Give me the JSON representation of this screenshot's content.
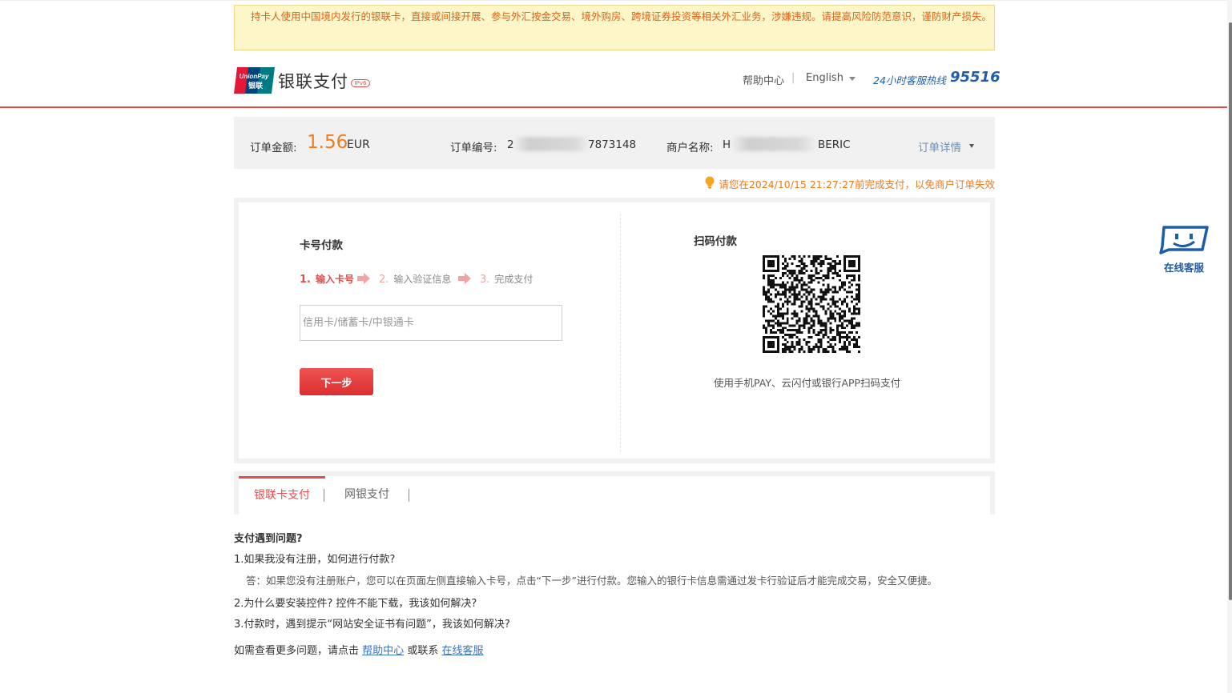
{
  "warning": "持卡人使用中国境内发行的银联卡，直接或间接开展、参与外汇按金交易、境外购房、跨境证券投资等相关外汇业务，涉嫌违规。请提高风险防范意识，谨防财产损失。",
  "header": {
    "logo_text": "UnionPay 银联",
    "brand_title": "银联支付",
    "ipv6_tag": "IPv6",
    "help_center": "帮助中心",
    "separator": "|",
    "language": "English",
    "hotline_label": "24小时客服热线",
    "hotline_number": "95516"
  },
  "order": {
    "amount_label": "订单金额:",
    "amount_value": "1.56",
    "currency": "EUR",
    "order_no_label": "订单编号:",
    "order_no_prefix": "2",
    "order_no_suffix": "7873148",
    "merchant_label": "商户名称:",
    "merchant_prefix": "H",
    "merchant_suffix": "BERIC",
    "details_link": "订单详情"
  },
  "deadline": "请您在2024/10/15 21:27:27前完成支付，以免商户订单失效",
  "card_pay": {
    "title": "卡号付款",
    "steps": [
      {
        "num": "1.",
        "label": "输入卡号"
      },
      {
        "num": "2.",
        "label": "输入验证信息"
      },
      {
        "num": "3.",
        "label": "完成支付"
      }
    ],
    "input_placeholder": "信用卡/储蓄卡/中银通卡",
    "next_button": "下一步"
  },
  "qr_pay": {
    "title": "扫码付款",
    "hint": "使用手机PAY、云闪付或银行APP扫码支付"
  },
  "tabs": [
    {
      "label": "银联卡支付",
      "active": true
    },
    {
      "label": "网银支付",
      "active": false
    }
  ],
  "faq": {
    "title": "支付遇到问题?",
    "items": [
      {
        "q": "1.如果我没有注册，如何进行付款?",
        "a": "答：如果您没有注册账户，您可以在页面左侧直接输入卡号，点击“下一步”进行付款。您输入的银行卡信息需通过发卡行验证后才能完成交易，安全又便捷。"
      },
      {
        "q": "2.为什么要安装控件? 控件不能下载，我该如何解决?",
        "a": ""
      },
      {
        "q": "3.付款时，遇到提示“网站安全证书有问题”，我该如何解决?",
        "a": ""
      }
    ],
    "more_prefix": "如需查看更多问题，请点击",
    "more_help_link": "帮助中心",
    "more_or": "或联系",
    "more_cs_link": "在线客服"
  },
  "customer_service": {
    "label": "在线客服"
  },
  "colors": {
    "brand_red": "#e34d4d",
    "amount_orange": "#f07a1c",
    "link_blue": "#3c73c2",
    "hotline_blue": "#1f5fa8"
  }
}
